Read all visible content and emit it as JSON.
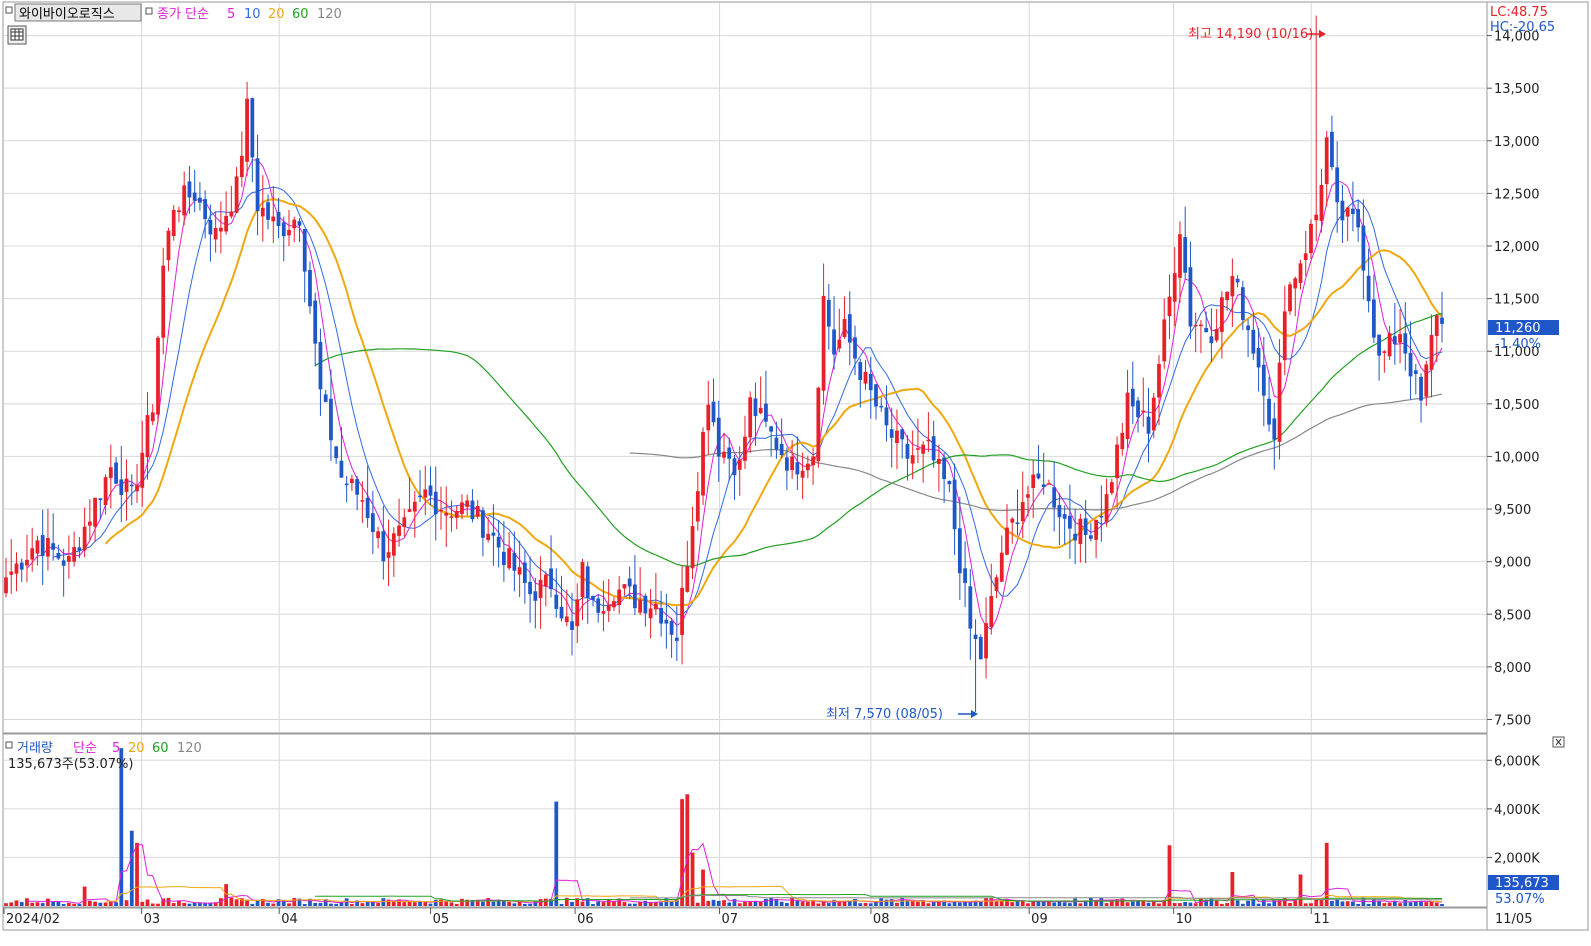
{
  "window": {
    "stock_name": "와이바이오로직스",
    "price_ma_label": "종가 단순",
    "price_ma_periods": [
      "5",
      "10",
      "20",
      "60",
      "120"
    ],
    "volume_label": "거래량",
    "volume_ma_label": "단순",
    "volume_ma_periods": [
      "5",
      "20",
      "60",
      "120"
    ],
    "volume_info": "135,673주(53.07%)",
    "lc_label": "LC:48.75",
    "hc_label": "HC:-20.65",
    "max_label": "최고 14,190 (10/16)",
    "min_label": "최저 7,570 (08/05)",
    "current_price_label": "11,260",
    "current_change_label": "-1.40%",
    "current_volume_label": "135,673",
    "current_volume_pct_label": "53.07%",
    "grid_icon": "grid-table-icon",
    "close_icon": "close-x-icon"
  },
  "colors": {
    "up": "#e8202a",
    "down": "#1f57c9",
    "ma5": "#e020d8",
    "ma10": "#3068e8",
    "ma20": "#f0a810",
    "ma60": "#22a022",
    "ma120": "#888888",
    "grid": "#d8d8d8",
    "price_tag_bg": "#1f57c9"
  },
  "chart_data": [
    {
      "type": "candlestick",
      "title": "와이바이오로직스",
      "x_tick_labels": [
        "2024/02",
        "03",
        "04",
        "05",
        "06",
        "07",
        "08",
        "09",
        "10",
        "11",
        "11/05"
      ],
      "y_tick_labels": [
        "7,500",
        "8,000",
        "8,500",
        "9,000",
        "9,500",
        "10,000",
        "10,500",
        "11,000",
        "11,500",
        "12,000",
        "12,500",
        "13,000",
        "13,500",
        "14,000"
      ],
      "ylim": [
        7400,
        14300
      ],
      "series": [
        {
          "name": "5",
          "role": "ma"
        },
        {
          "name": "10",
          "role": "ma"
        },
        {
          "name": "20",
          "role": "ma"
        },
        {
          "name": "60",
          "role": "ma"
        },
        {
          "name": "120",
          "role": "ma"
        }
      ],
      "high": 14190,
      "high_date": "10/16",
      "low": 7570,
      "low_date": "08/05",
      "last_close": 11260,
      "last_change_pct": -1.4
    },
    {
      "type": "bar",
      "title": "거래량",
      "y_tick_labels": [
        "2,000K",
        "4,000K",
        "6,000K"
      ],
      "ylim": [
        0,
        7000
      ],
      "series": [
        {
          "name": "5",
          "role": "ma"
        },
        {
          "name": "20",
          "role": "ma"
        },
        {
          "name": "60",
          "role": "ma"
        },
        {
          "name": "120",
          "role": "ma"
        }
      ],
      "last_volume": 135673,
      "last_volume_pct": 53.07
    }
  ]
}
